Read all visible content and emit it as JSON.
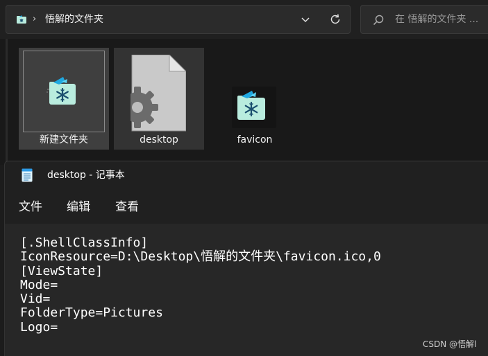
{
  "explorer": {
    "address": {
      "path": "悟解的文件夹",
      "separator": "›"
    },
    "search": {
      "placeholder": "在 悟解的文件夹 ..."
    },
    "items": [
      {
        "label": "新建文件夹",
        "icon": "snowflake-folder-icon",
        "state": "selected"
      },
      {
        "label": "desktop",
        "icon": "settings-file-icon",
        "state": "hovered"
      },
      {
        "label": "favicon",
        "icon": "snowflake-folder-icon",
        "state": "normal"
      }
    ]
  },
  "notepad": {
    "title": "desktop - 记事本",
    "menu": [
      "文件",
      "编辑",
      "查看"
    ],
    "content": "[.ShellClassInfo]\nIconResource=D:\\Desktop\\悟解的文件夹\\favicon.ico,0\n[ViewState]\nMode=\nVid=\nFolderType=Pictures\nLogo="
  },
  "watermark": "CSDN @悟解l",
  "colors": {
    "folder_teal": "#b9ecde",
    "folder_blue": "#1fa8e0",
    "snowflake": "#1a4e6e",
    "gear": "#6b6b6b",
    "file_page": "#c8c8c8"
  }
}
